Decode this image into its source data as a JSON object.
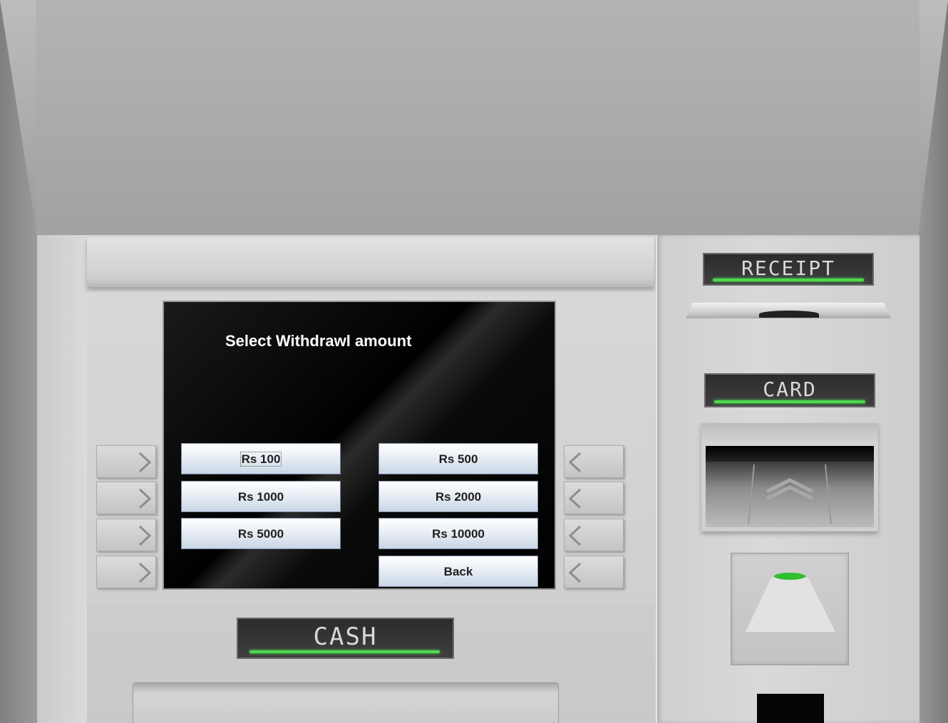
{
  "screen": {
    "title": "Select Withdrawl amount",
    "buttons": {
      "rs100": "Rs 100",
      "rs500": "Rs 500",
      "rs1000": "Rs 1000",
      "rs2000": "Rs 2000",
      "rs5000": "Rs 5000",
      "rs10000": "Rs 10000",
      "back": "Back"
    }
  },
  "labels": {
    "receipt": "RECEIPT",
    "card": "CARD",
    "cash": "CASH"
  },
  "colors": {
    "indicator_green": "#4cd94c",
    "screen_bg": "#000000"
  }
}
